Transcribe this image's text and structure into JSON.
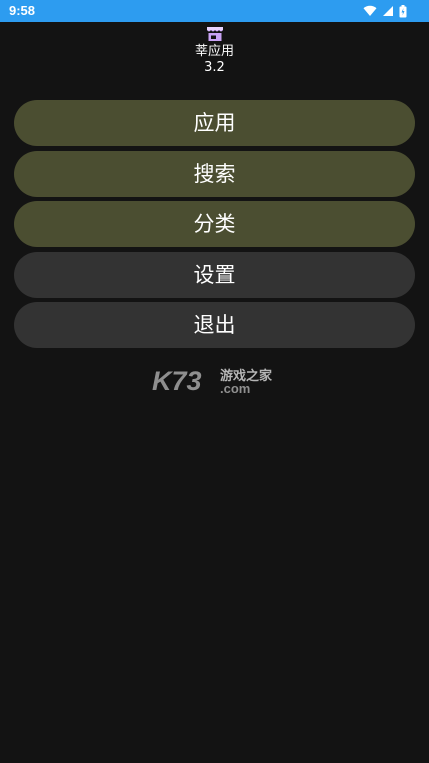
{
  "status_bar": {
    "time": "9:58",
    "background": "#2d9cf0",
    "icons": [
      "wifi-icon",
      "cellular-signal-icon",
      "battery-icon"
    ]
  },
  "header": {
    "icon": "store-icon",
    "app_name": "莘应用",
    "version": "3.2"
  },
  "menu": {
    "items": [
      {
        "label": "应用",
        "style": "primary"
      },
      {
        "label": "搜索",
        "style": "primary"
      },
      {
        "label": "分类",
        "style": "primary"
      },
      {
        "label": "设置",
        "style": "secondary"
      },
      {
        "label": "退出",
        "style": "secondary"
      }
    ],
    "primary_color": "#4b4e31",
    "secondary_color": "#333333"
  },
  "watermark": {
    "brand": "K73",
    "tagline": "游戏之家",
    "domain": ".com"
  }
}
